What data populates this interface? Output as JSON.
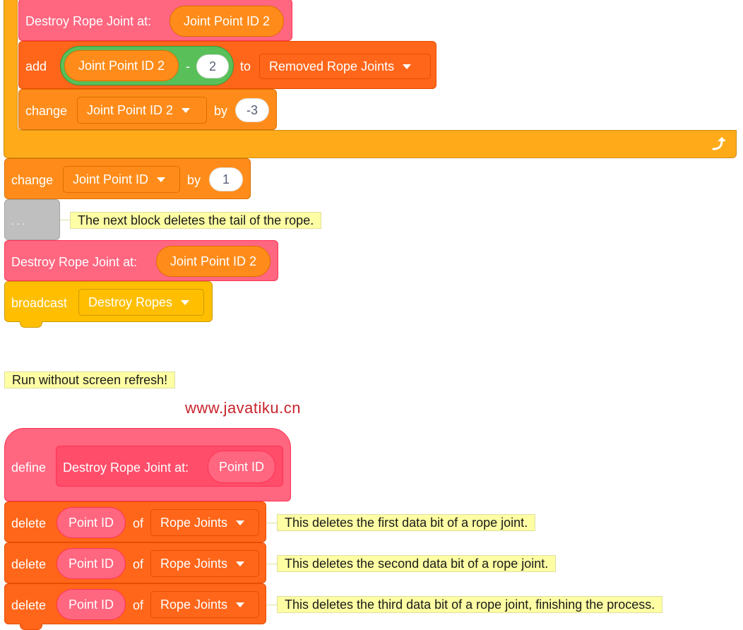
{
  "top_blocks": {
    "destroy_1": {
      "label": "Destroy Rope Joint at:",
      "arg": "Joint Point ID 2"
    },
    "add": {
      "label": "add",
      "left_arg": "Joint Point ID 2",
      "operator": "-",
      "right_arg": "2",
      "to_label": "to",
      "list": "Removed Rope Joints"
    },
    "change_inner": {
      "label": "change",
      "variable": "Joint Point ID 2",
      "by_label": "by",
      "value": "-3"
    },
    "loop_arrow_icon": "loop-arrow-icon",
    "change_outer": {
      "label": "change",
      "variable": "Joint Point ID",
      "by_label": "by",
      "value": "1"
    },
    "comment_block": {
      "label": ". . .",
      "note": "The next block deletes the tail of the rope."
    },
    "destroy_2": {
      "label": "Destroy Rope Joint at:",
      "arg": "Joint Point ID 2"
    },
    "broadcast": {
      "label": "broadcast",
      "message": "Destroy Ropes"
    }
  },
  "run_note": "Run without screen refresh!",
  "watermark": "www.javatiku.cn",
  "define_block": {
    "label": "define",
    "proc_label": "Destroy Rope Joint at:",
    "param": "Point ID",
    "deletes": [
      {
        "label": "delete",
        "arg": "Point ID",
        "of_label": "of",
        "list": "Rope Joints",
        "note": "This deletes the first data bit of a rope joint."
      },
      {
        "label": "delete",
        "arg": "Point ID",
        "of_label": "of",
        "list": "Rope Joints",
        "note": "This deletes the second data bit of a rope joint."
      },
      {
        "label": "delete",
        "arg": "Point ID",
        "of_label": "of",
        "list": "Rope Joints",
        "note": "This deletes the third data bit of a rope joint, finishing the process."
      }
    ]
  },
  "colors": {
    "control": "#ffab19",
    "control_border": "#cf8b17",
    "variables": "#ff8c1a",
    "variables_border": "#db6e00",
    "lists": "#ff661a",
    "lists_border": "#e64d00",
    "custom": "#ff6680",
    "custom_border": "#ff3355",
    "operators": "#59c059",
    "operators_border": "#389438",
    "events": "#ffbf00",
    "events_border": "#cc9900",
    "comment_gray": "#bfbfbf",
    "note_bg": "#fefea4"
  }
}
